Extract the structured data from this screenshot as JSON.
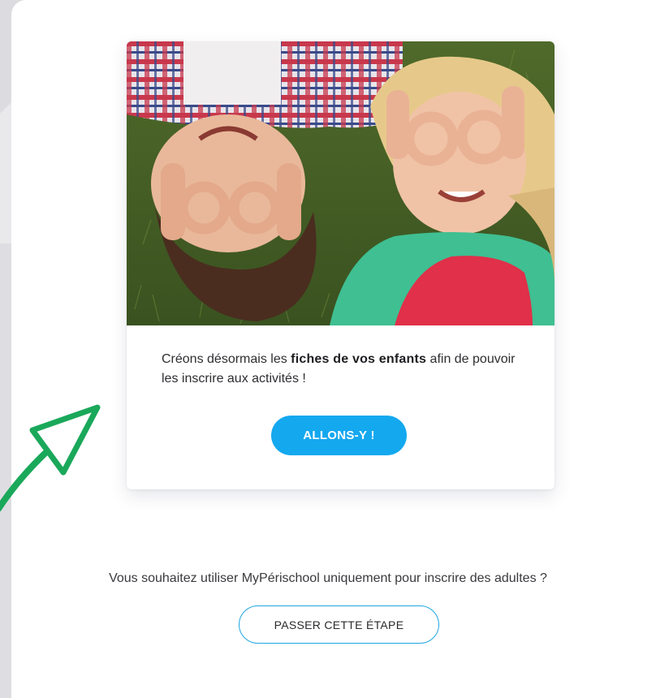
{
  "card": {
    "image_alt": "children lying on grass",
    "text_prefix": "Créons désormais les ",
    "text_bold": "fiches de vos enfants",
    "text_suffix": " afin de pouvoir les inscrire aux activités !",
    "cta_label": "ALLONS-Y !"
  },
  "footer": {
    "question": "Vous souhaitez utiliser MyPérischool uniquement pour inscrire des adultes ?",
    "skip_label": "PASSER CETTE ÉTAPE"
  },
  "colors": {
    "accent_blue": "#14a8ef",
    "arrow_green": "#1aa85a"
  },
  "icons": {
    "annotation": "arrow-up-right-icon"
  }
}
